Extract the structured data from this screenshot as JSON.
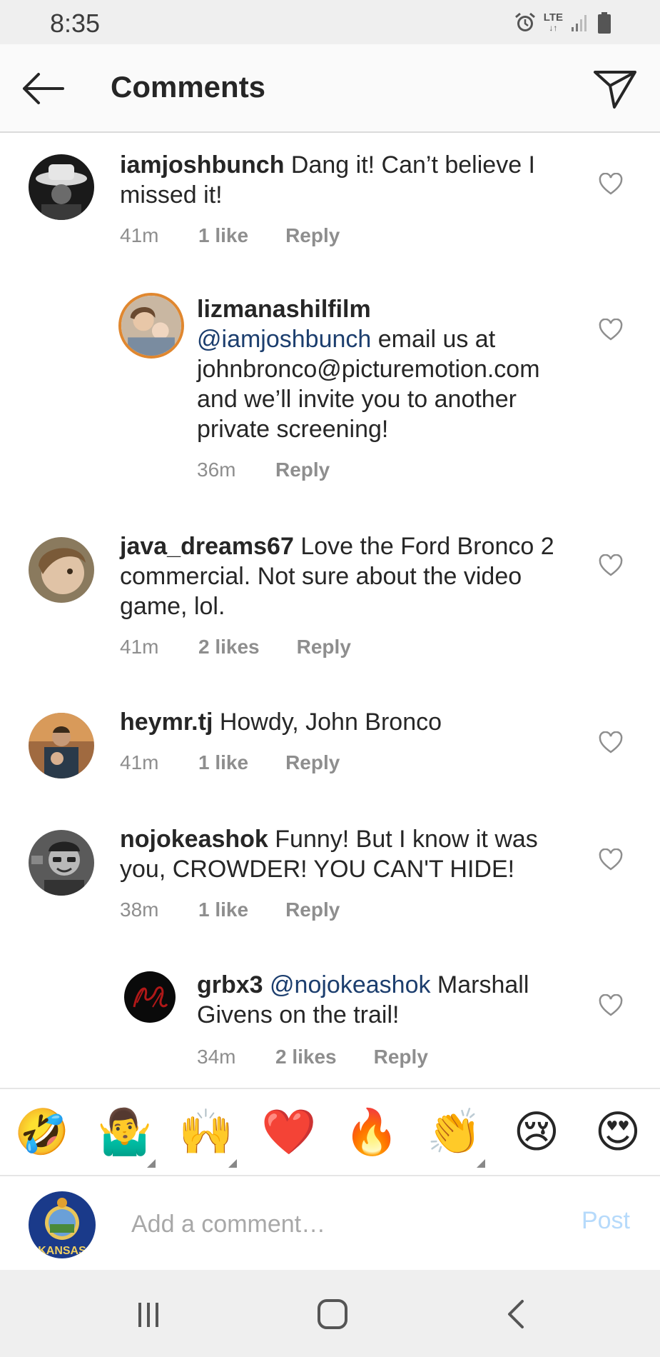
{
  "status_bar": {
    "time": "8:35",
    "network": "LTE"
  },
  "header": {
    "title": "Comments"
  },
  "comments": [
    {
      "username": "iamjoshbunch",
      "mention": "",
      "text": " Dang it! Can’t believe I missed it!",
      "time": "41m",
      "likes": "1 like",
      "reply": "Reply"
    },
    {
      "username": "lizmanashilfilm",
      "mention": "@iamjoshbunch",
      "text": " email us at johnbronco@picturemotion.com and we’ll invite you to another private screening!",
      "time": "36m",
      "likes": "",
      "reply": "Reply"
    },
    {
      "username": "java_dreams67",
      "mention": "",
      "text": " Love the Ford Bronco 2 commercial. Not sure about the video game, lol.",
      "time": "41m",
      "likes": "2 likes",
      "reply": "Reply"
    },
    {
      "username": "heymr.tj",
      "mention": "",
      "text": " Howdy, John Bronco",
      "time": "41m",
      "likes": "1 like",
      "reply": "Reply"
    },
    {
      "username": "nojokeashok",
      "mention": "",
      "text": " Funny! But I know it was you, CROWDER! YOU CAN'T HIDE!",
      "time": "38m",
      "likes": "1 like",
      "reply": "Reply"
    },
    {
      "username": "grbx3",
      "mention": "@nojokeashok",
      "text": " Marshall Givens on the trail!",
      "time": "34m",
      "likes": "2 likes",
      "reply": "Reply"
    }
  ],
  "emoji_bar": [
    {
      "glyph": "🤣",
      "icon": "rofl-emoji-icon"
    },
    {
      "glyph": "🤷‍♂️",
      "icon": "shrug-emoji-icon"
    },
    {
      "glyph": "🙌",
      "icon": "raised-hands-emoji-icon"
    },
    {
      "glyph": "❤️",
      "icon": "red-heart-emoji-icon"
    },
    {
      "glyph": "🔥",
      "icon": "fire-emoji-icon"
    },
    {
      "glyph": "👏",
      "icon": "clapping-emoji-icon"
    },
    {
      "glyph": "😢",
      "icon": "crying-emoji-icon"
    },
    {
      "glyph": "😍",
      "icon": "heart-eyes-emoji-icon"
    }
  ],
  "composer": {
    "placeholder": "Add a comment…",
    "post_label": "Post",
    "avatar_text": "KANSAS"
  },
  "colors": {
    "mention": "#1c3e6e",
    "post_disabled": "#b6dafb",
    "meta": "#8e8e8e"
  }
}
